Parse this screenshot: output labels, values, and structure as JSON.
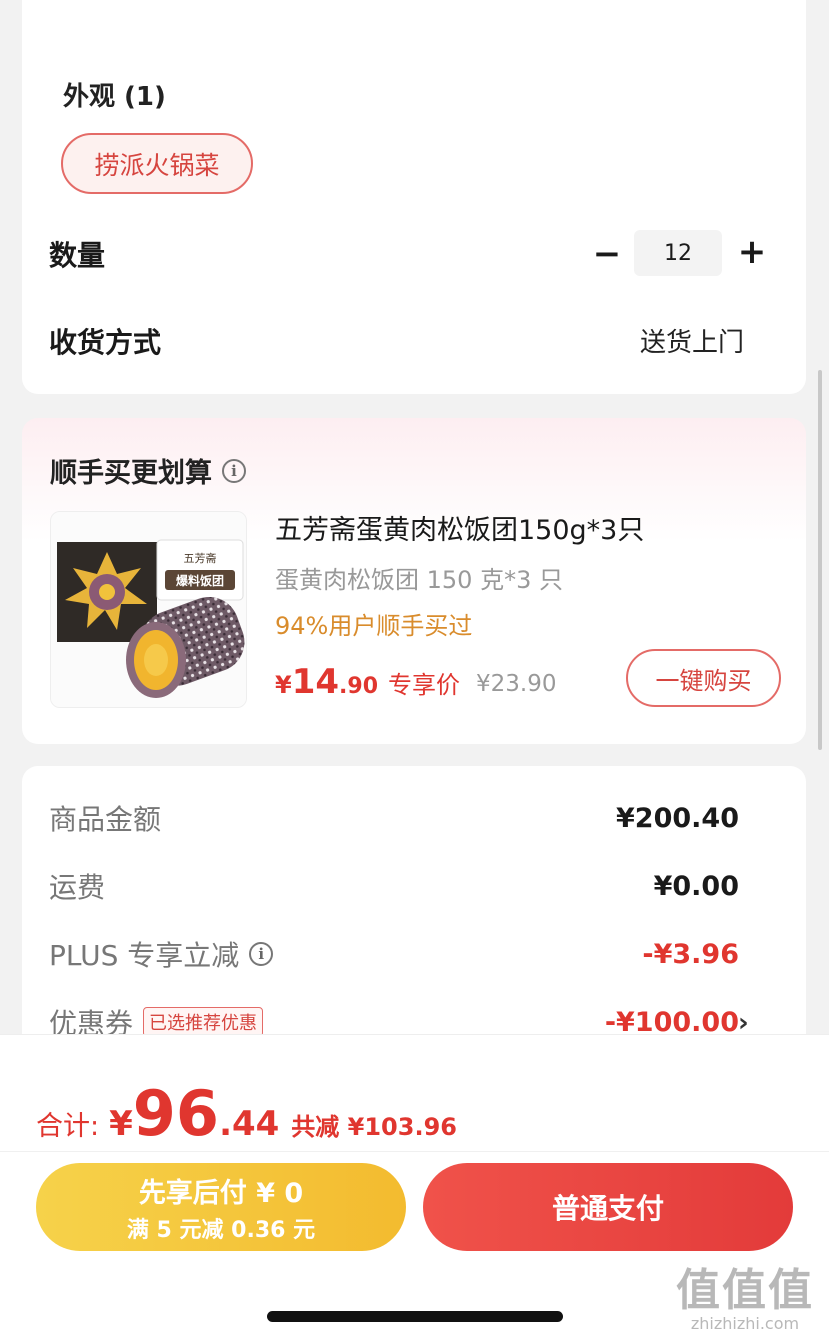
{
  "spec": {
    "appearance_title": "外观 (1)",
    "appearance_option": "捞派火锅菜",
    "quantity_label": "数量",
    "quantity_minus": "−",
    "quantity_value": "12",
    "quantity_plus": "+",
    "shipping_label": "收货方式",
    "shipping_value": "送货上门"
  },
  "upsell": {
    "title": "顺手买更划算",
    "info_icon": "info-circle-icon",
    "product": {
      "name": "五芳斋蛋黄肉松饭团150g*3只",
      "spec": "蛋黄肉松饭团 150 克*3 只",
      "bought": "94%用户顺手买过",
      "price_symbol": "¥",
      "price_int": "14",
      "price_dec": ".90",
      "price_tag": "专享价",
      "old_price": "¥23.90",
      "image_text_top": "五芳斋",
      "image_text_main": "爆料饭团"
    },
    "buy_button": "一键购买"
  },
  "amounts": {
    "goods_label": "商品金额",
    "goods_value": "¥200.40",
    "freight_label": "运费",
    "freight_value": "¥0.00",
    "plus_label": "PLUS 专享立减",
    "plus_value": "-¥3.96",
    "coupon_label": "优惠券",
    "coupon_badge": "已选推荐优惠",
    "coupon_value": "-¥100.00",
    "chevron": "›"
  },
  "footer": {
    "total_label": "合计:",
    "total_symbol": "¥",
    "total_int": "96",
    "total_dec": ".44",
    "total_saved": "共减 ¥103.96",
    "pay_later_line1": "先享后付 ¥ 0",
    "pay_later_line2": "满 5 元减 0.36 元",
    "pay_button": "普通支付"
  },
  "watermark": {
    "glyphs": "值值值",
    "url": "zhizhizhi.com"
  },
  "colors": {
    "accent_red": "#e0362f",
    "chip_border": "#e46b67",
    "bought_orange": "#d98c2c",
    "pay_later_yellow": "#f3bb2f"
  }
}
